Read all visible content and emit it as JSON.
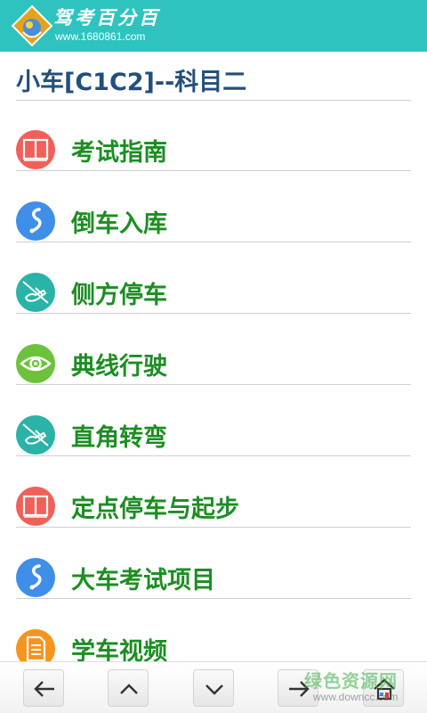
{
  "header": {
    "brand_title": "驾考百分百",
    "brand_url": "www.1680861.com",
    "bg_color": "#2fc3c0"
  },
  "page_title": "小车[C1C2]--科目二",
  "menu": {
    "items": [
      {
        "label": "考试指南",
        "icon": "book-icon",
        "icon_color": "#f0605a"
      },
      {
        "label": "倒车入库",
        "icon": "route-icon",
        "icon_color": "#3f8ee8"
      },
      {
        "label": "侧方停车",
        "icon": "hand-writing-icon",
        "icon_color": "#2ab3a6"
      },
      {
        "label": "典线行驶",
        "icon": "eye-icon",
        "icon_color": "#6cc23b"
      },
      {
        "label": "直角转弯",
        "icon": "hand-writing-icon",
        "icon_color": "#2ab3a6"
      },
      {
        "label": "定点停车与起步",
        "icon": "book-icon",
        "icon_color": "#f0605a"
      },
      {
        "label": "大车考试项目",
        "icon": "route-icon",
        "icon_color": "#3f8ee8"
      },
      {
        "label": "学车视频",
        "icon": "document-icon",
        "icon_color": "#f5941f"
      }
    ],
    "label_color": "#1d8d24"
  },
  "toolbar": {
    "buttons": [
      "back-arrow-icon",
      "up-chevron-icon",
      "down-chevron-icon",
      "forward-arrow-icon",
      "home-icon"
    ]
  },
  "watermark": {
    "text": "绿色资源网",
    "url": "www.downcc.com"
  }
}
